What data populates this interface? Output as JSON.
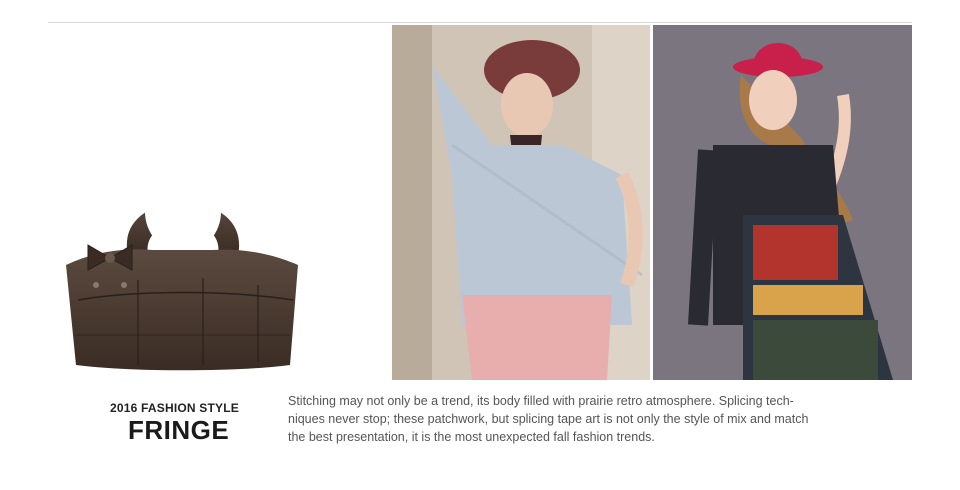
{
  "caption": {
    "kicker": "2016 FASHION STYLE",
    "headline": "FRINGE",
    "body_lines": [
      "Stitching may not only be a trend, its body filled with prairie retro atmosphere. Splicing tech-",
      "niques never stop; these patchwork, but splicing tape art is not only the style of mix and match",
      "the best presentation, it is the most unexpected fall fashion trends."
    ]
  },
  "colors": {
    "bag_leather": "#4a3a30",
    "hat_red": "#c8204a",
    "backdrop_gray": "#7b7580"
  }
}
